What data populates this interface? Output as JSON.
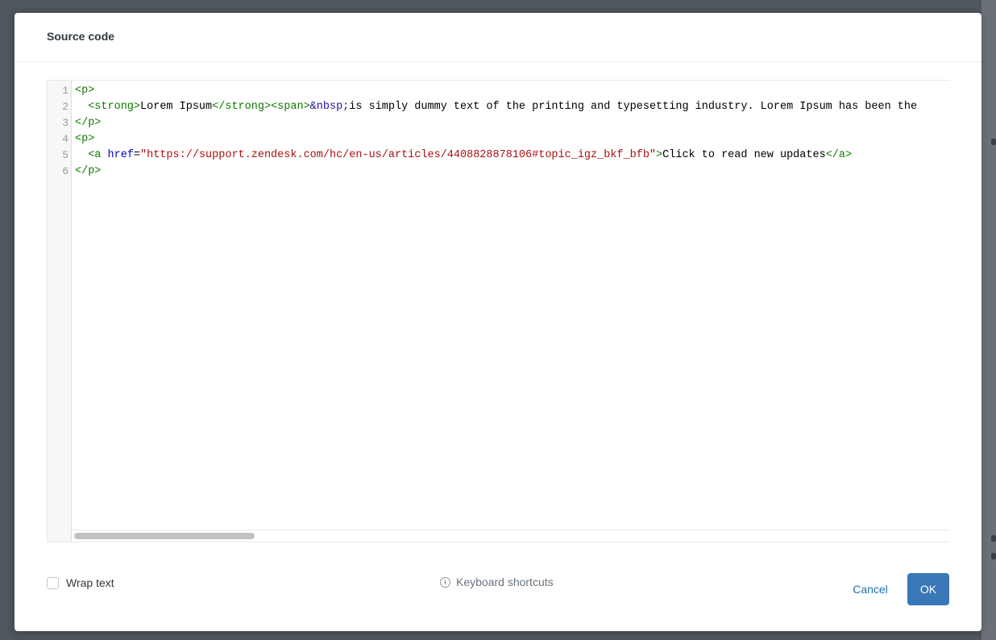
{
  "dialog": {
    "title": "Source code"
  },
  "editor": {
    "line_numbers": [
      "1",
      "2",
      "3",
      "4",
      "5",
      "6"
    ],
    "lines": [
      [
        {
          "t": "tag",
          "v": "<p>"
        }
      ],
      [
        {
          "t": "plain",
          "v": "  "
        },
        {
          "t": "tag",
          "v": "<strong>"
        },
        {
          "t": "plain",
          "v": "Lorem Ipsum"
        },
        {
          "t": "tag",
          "v": "</strong>"
        },
        {
          "t": "tag",
          "v": "<span>"
        },
        {
          "t": "ent",
          "v": "&nbsp;"
        },
        {
          "t": "plain",
          "v": "is simply dummy text of the printing and typesetting industry. Lorem Ipsum has been the"
        }
      ],
      [
        {
          "t": "tag",
          "v": "</p>"
        }
      ],
      [
        {
          "t": "tag",
          "v": "<p>"
        }
      ],
      [
        {
          "t": "plain",
          "v": "  "
        },
        {
          "t": "tag",
          "v": "<a "
        },
        {
          "t": "attr",
          "v": "href"
        },
        {
          "t": "plain",
          "v": "="
        },
        {
          "t": "str",
          "v": "\"https://support.zendesk.com/hc/en-us/articles/4408828878106#topic_igz_bkf_bfb\""
        },
        {
          "t": "tag",
          "v": ">"
        },
        {
          "t": "plain",
          "v": "Click to read new updates"
        },
        {
          "t": "tag",
          "v": "</a>"
        }
      ],
      [
        {
          "t": "tag",
          "v": "</p>"
        }
      ]
    ]
  },
  "footer": {
    "wrap_text_label": "Wrap text",
    "wrap_text_checked": false,
    "keyboard_shortcuts_label": "Keyboard shortcuts",
    "info_icon": "ⓘ",
    "cancel_label": "Cancel",
    "ok_label": "OK"
  },
  "colors": {
    "accent": "#1f73b7",
    "ok_button": "#3977b6",
    "tag": "#117700",
    "attribute": "#0000cc",
    "string": "#aa1111",
    "entity": "#221199"
  },
  "icons": {
    "info": "info-icon",
    "checkbox": "checkbox-icon"
  }
}
